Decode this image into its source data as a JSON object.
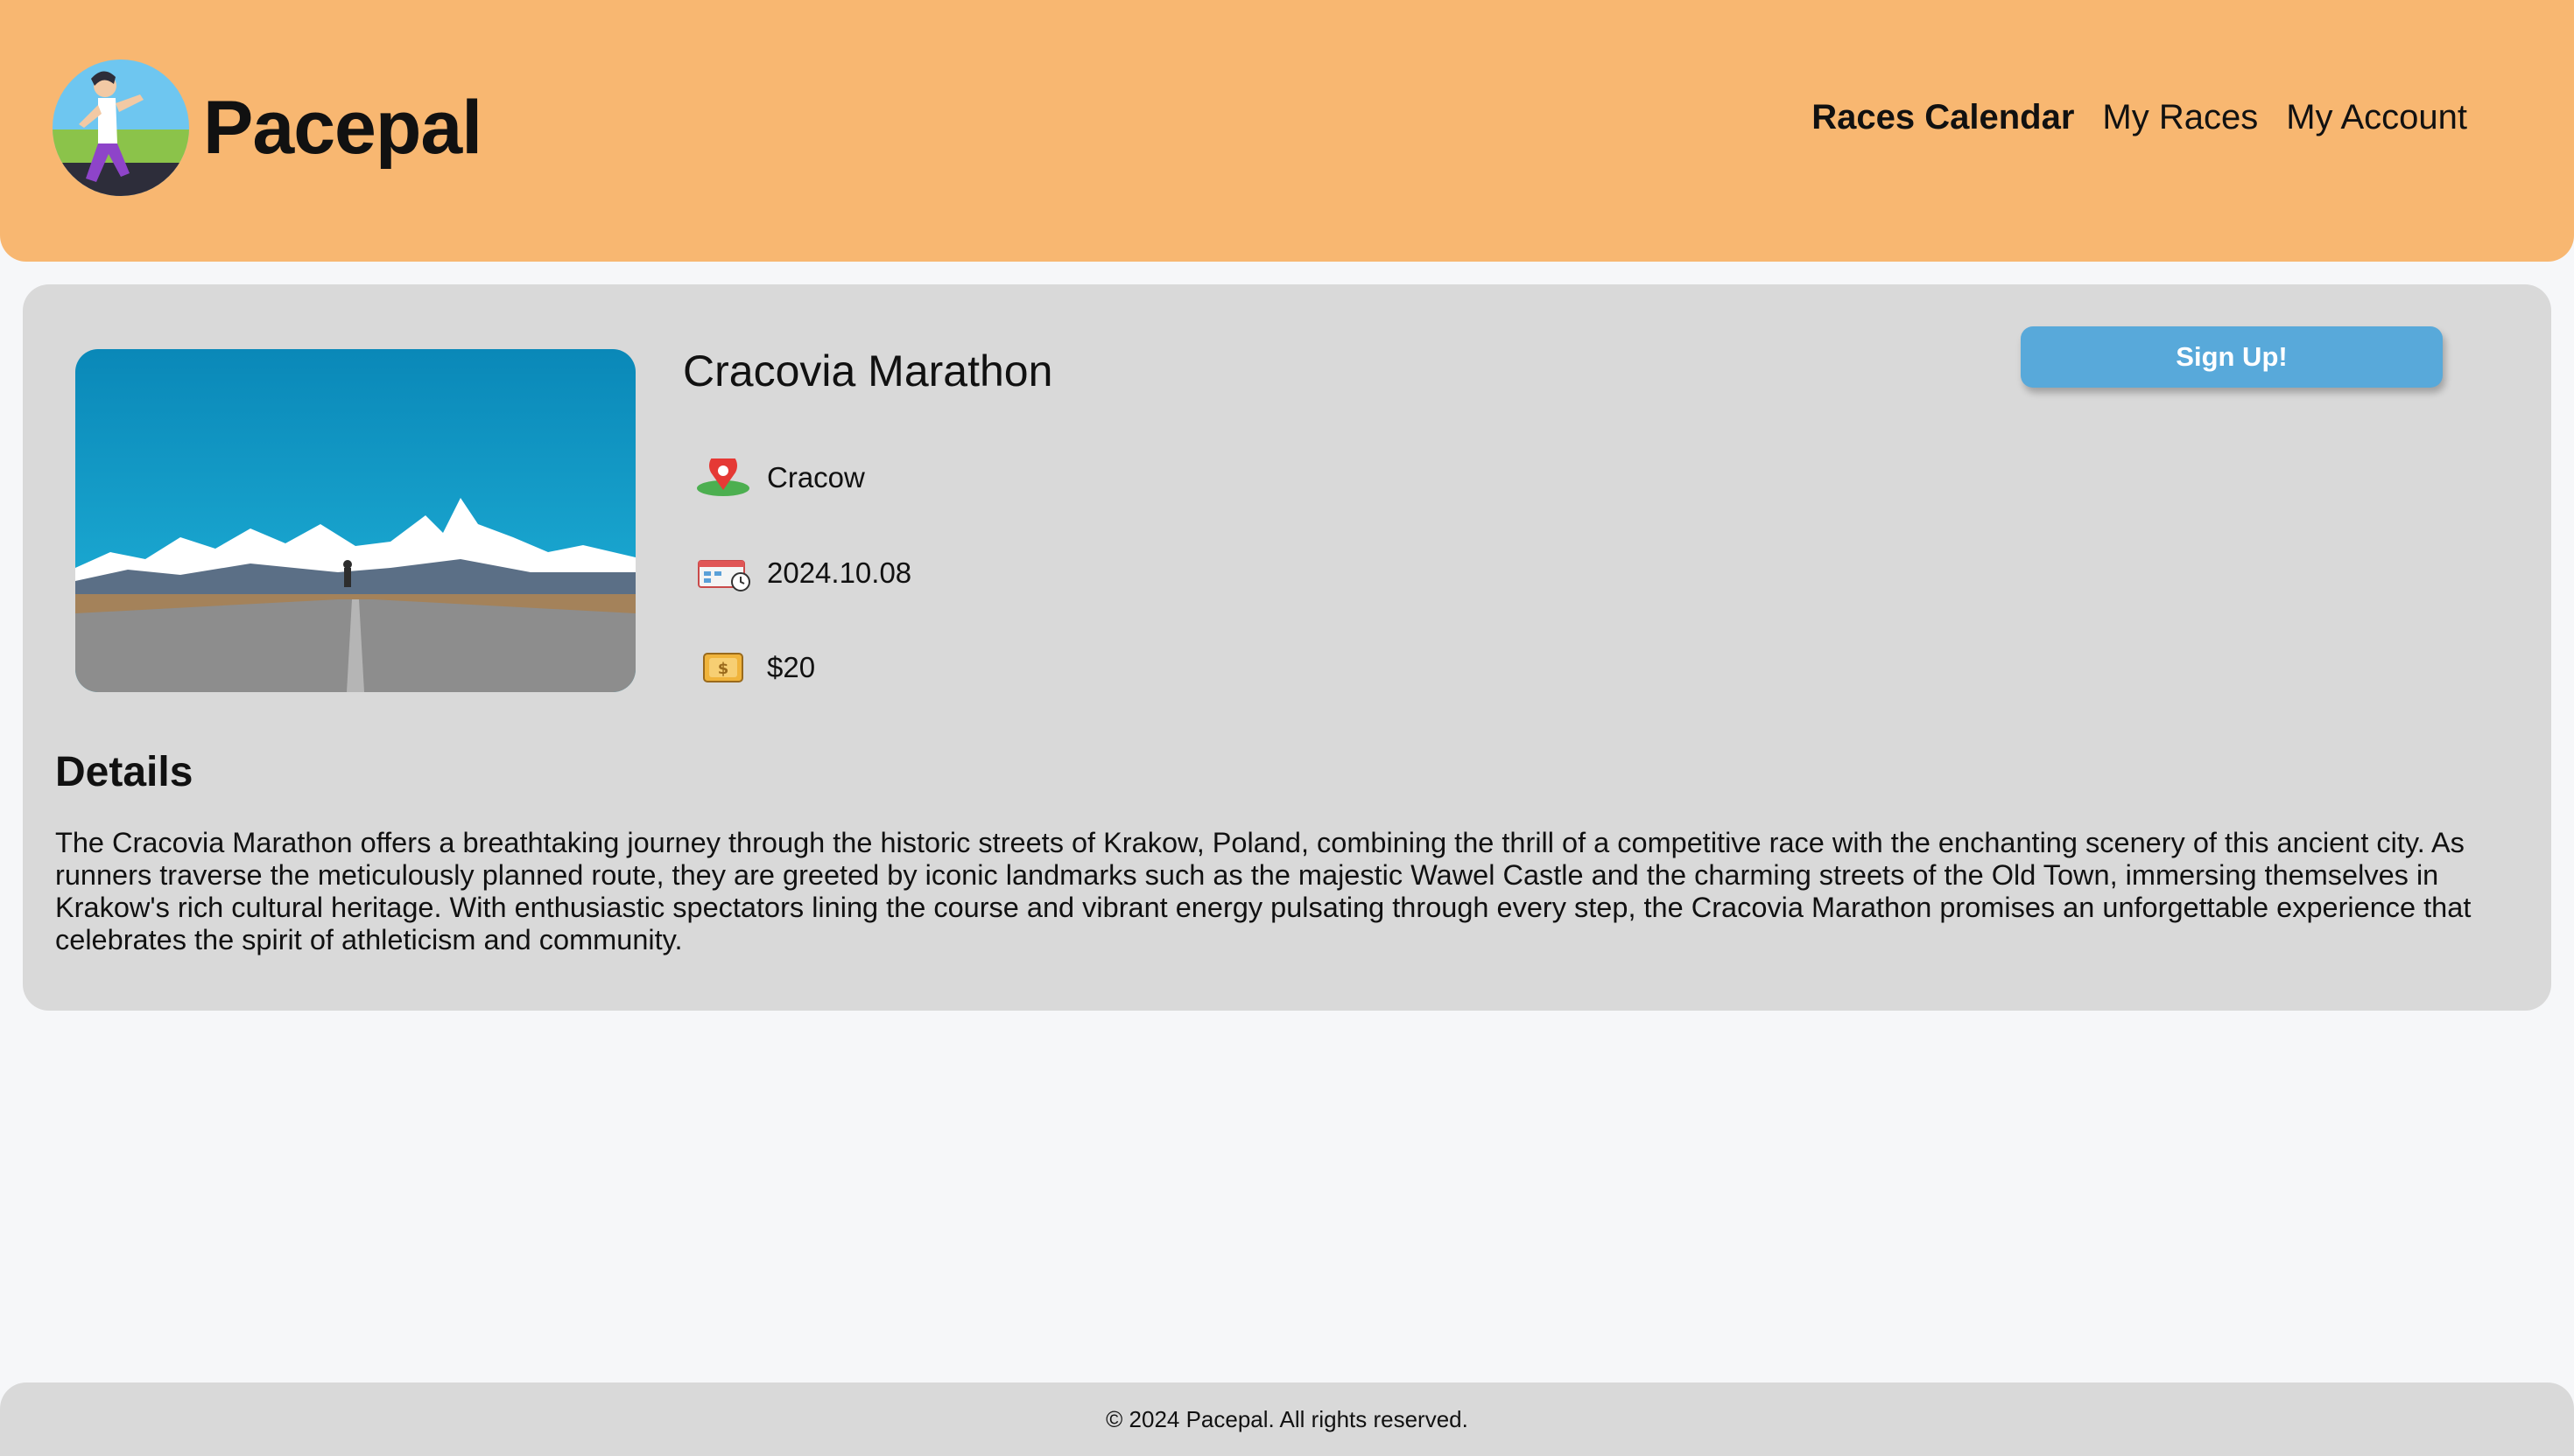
{
  "header": {
    "brand": "Pacepal",
    "logo_icon": "runner-logo-icon",
    "nav": [
      {
        "label": "Races Calendar",
        "active": true
      },
      {
        "label": "My Races",
        "active": false
      },
      {
        "label": "My Account",
        "active": false
      }
    ],
    "bg_color": "#f8b771"
  },
  "race": {
    "title": "Cracovia Marathon",
    "photo": "mountain-road-runner-photo",
    "location": {
      "icon": "map-pin-icon",
      "value": "Cracow"
    },
    "date": {
      "icon": "calendar-clock-icon",
      "value": "2024.10.08"
    },
    "price": {
      "icon": "money-icon",
      "value": "$20"
    },
    "signup_label": "Sign Up!",
    "signup_color": "#58a9da"
  },
  "details": {
    "heading": "Details",
    "text": "The Cracovia Marathon offers a breathtaking journey through the historic streets of Krakow, Poland, combining the thrill of a competitive race with the enchanting scenery of this ancient city. As runners traverse the meticulously planned route, they are greeted by iconic landmarks such as the majestic Wawel Castle and the charming streets of the Old Town, immersing themselves in Krakow's rich cultural heritage. With enthusiastic spectators lining the course and vibrant energy pulsating through every step, the Cracovia Marathon promises an unforgettable experience that celebrates the spirit of athleticism and community."
  },
  "footer": {
    "text": "© 2024 Pacepal. All rights reserved."
  }
}
